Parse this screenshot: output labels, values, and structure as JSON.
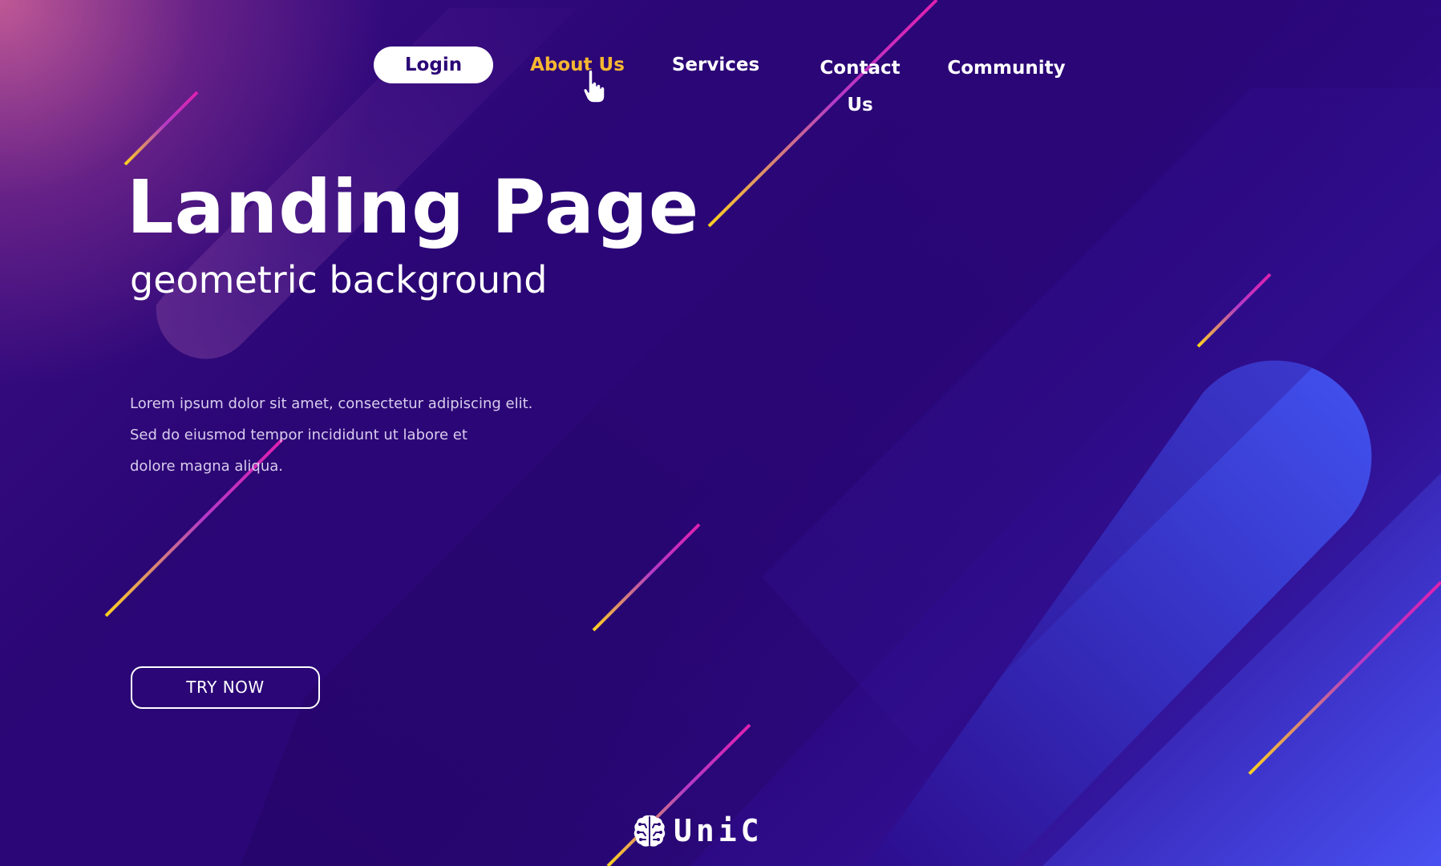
{
  "nav": {
    "login_label": "Login",
    "about_label": "About Us",
    "services_label": "Services",
    "contact_label": "Contact Us",
    "community_label": "Community",
    "active_item": "About Us"
  },
  "hero": {
    "title": "Landing Page",
    "subtitle": "geometric background",
    "body_lines": [
      "Lorem ipsum dolor sit amet, consectetur adipiscing elit.",
      "Sed do eiusmod tempor incididunt ut labore et",
      "dolore magna aliqua."
    ],
    "cta_label": "TRY NOW"
  },
  "brand": {
    "logo_text": "UniC",
    "logo_icon": "brain-circuit-icon"
  },
  "colors": {
    "accent_hover": "#f5b731",
    "background_dark": "#2b0675",
    "background_light": "#3f4ff0",
    "line_start": "#ffd21f",
    "line_end": "#e020b0"
  },
  "icons": {
    "cursor": "hand-pointer-icon"
  }
}
